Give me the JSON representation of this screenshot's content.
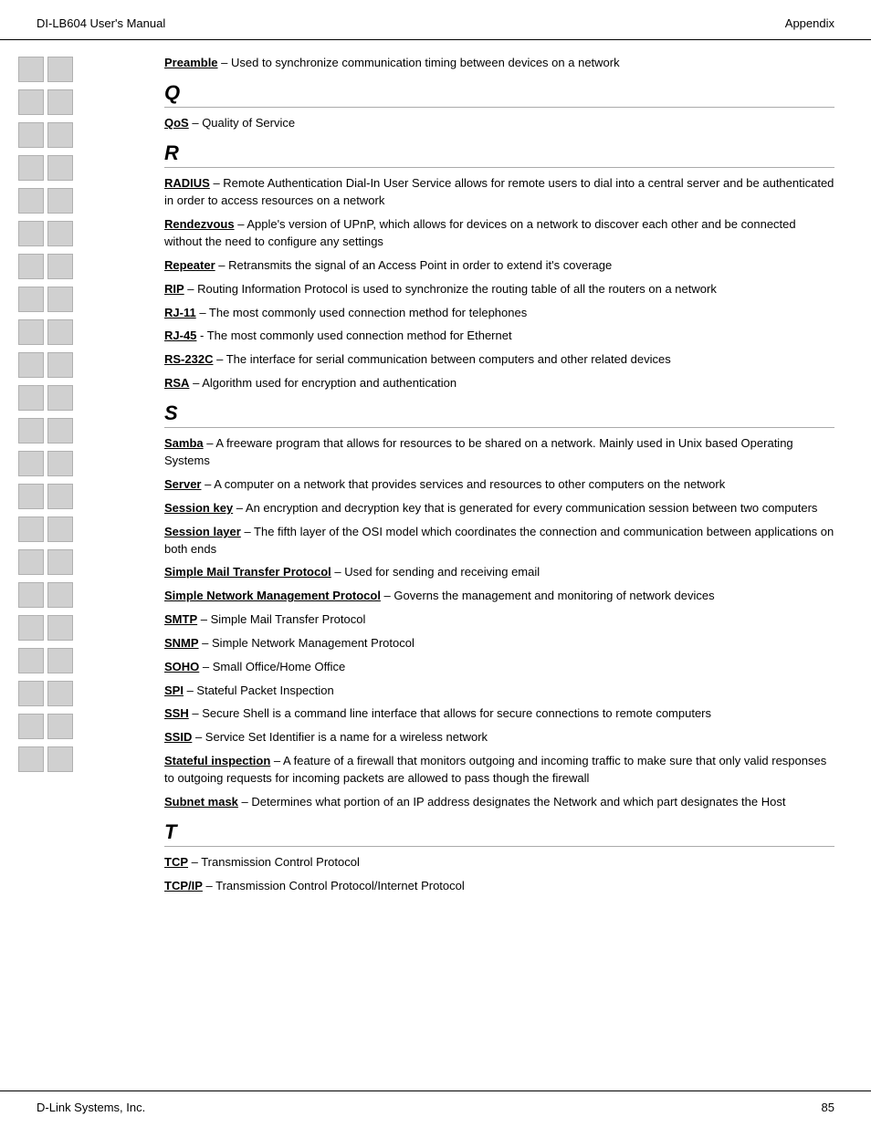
{
  "header": {
    "left": "DI-LB604 User's Manual",
    "right": "Appendix"
  },
  "footer": {
    "left": "D-Link Systems, Inc.",
    "right": "85"
  },
  "sections": [
    {
      "id": "preamble-section",
      "letter": null,
      "entries": [
        {
          "term": "Preamble",
          "definition": " – Used to synchronize communication timing between devices on a network"
        }
      ]
    },
    {
      "id": "q-section",
      "letter": "Q",
      "entries": [
        {
          "term": "QoS",
          "definition": " – Quality of Service"
        }
      ]
    },
    {
      "id": "r-section",
      "letter": "R",
      "entries": [
        {
          "term": "RADIUS",
          "definition": " – Remote Authentication Dial-In User Service allows for remote users to dial into a central server and be authenticated in order to access resources on a network"
        },
        {
          "term": "Rendezvous",
          "definition": " – Apple's version of UPnP, which allows for devices on a network to discover each other and be connected without the need to configure any settings"
        },
        {
          "term": "Repeater",
          "definition": " – Retransmits the signal of an Access Point in order to extend it's coverage"
        },
        {
          "term": "RIP",
          "definition": " – Routing Information Protocol is used to synchronize the routing table of all the routers on a network"
        },
        {
          "term": "RJ-11",
          "definition": " – The most commonly used connection method for telephones"
        },
        {
          "term": "RJ-45",
          "definition": " - The most commonly used connection method for Ethernet"
        },
        {
          "term": "RS-232C",
          "definition": " – The interface for serial communication between computers and other related devices"
        },
        {
          "term": "RSA",
          "definition": " – Algorithm used for encryption and authentication"
        }
      ]
    },
    {
      "id": "s-section",
      "letter": "S",
      "entries": [
        {
          "term": "Samba",
          "definition": " – A freeware program that allows for resources to be shared on a network.  Mainly used in Unix based Operating Systems"
        },
        {
          "term": "Server",
          "definition": " – A computer on a network that provides services and resources to other computers on the network"
        },
        {
          "term": "Session key",
          "definition": " – An encryption and decryption key that is generated for every communication session between two computers"
        },
        {
          "term": "Session layer",
          "definition": " – The fifth layer of the OSI model which coordinates the connection and communication between applications on both ends"
        },
        {
          "term": "Simple Mail Transfer Protocol",
          "definition": " – Used for sending and receiving email"
        },
        {
          "term": "Simple Network Management Protocol",
          "definition": " – Governs the management and monitoring of network devices"
        },
        {
          "term": "SMTP",
          "definition": " – Simple Mail Transfer Protocol"
        },
        {
          "term": "SNMP",
          "definition": " – Simple Network Management Protocol"
        },
        {
          "term": "SOHO",
          "definition": " – Small Office/Home Office"
        },
        {
          "term": "SPI",
          "definition": " – Stateful Packet Inspection"
        },
        {
          "term": "SSH",
          "definition": " – Secure Shell is a command line interface that allows for secure connections to remote computers"
        },
        {
          "term": "SSID",
          "definition": " – Service Set Identifier is a name for a wireless network"
        },
        {
          "term": "Stateful inspection",
          "definition": " – A feature of a firewall that monitors outgoing and incoming traffic to make sure that only valid responses to outgoing requests for incoming packets are allowed to pass though the firewall"
        },
        {
          "term": "Subnet mask",
          "definition": " – Determines what portion of an IP address designates the Network and which part designates the Host"
        }
      ]
    },
    {
      "id": "t-section",
      "letter": "T",
      "entries": [
        {
          "term": "TCP",
          "definition": " – Transmission Control Protocol"
        },
        {
          "term": "TCP/IP",
          "definition": " – Transmission Control Protocol/Internet Protocol"
        }
      ]
    }
  ],
  "sidebar_blocks_count": 22
}
